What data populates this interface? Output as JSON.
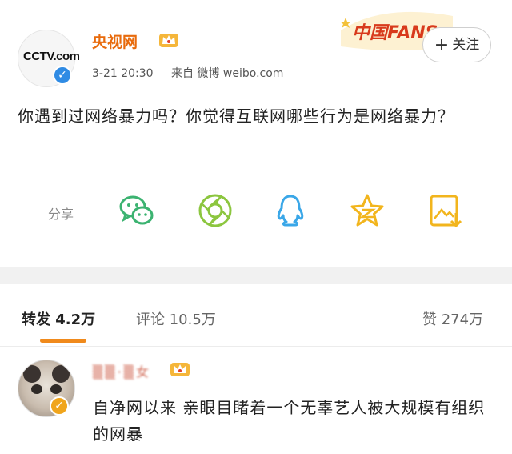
{
  "post": {
    "author": "央视网",
    "avatar_logo": "CCTV.com",
    "avatar_logo_small": "央视网",
    "time": "3-21 20:30",
    "source": "来自 微博 weibo.com",
    "follow_label": "关注",
    "text": "你遇到过网络暴力吗？你觉得互联网哪些行为是网络暴力？",
    "share_label": "分享",
    "share_icons": [
      "wechat-icon",
      "moments-icon",
      "qq-icon",
      "qzone-star-icon",
      "save-image-icon"
    ],
    "fans_badge": "中国FANS"
  },
  "stats": {
    "repost_label": "转发",
    "repost_count": "4.2万",
    "comment_label": "评论",
    "comment_count": "10.5万",
    "like_label": "赞",
    "like_count": "274万"
  },
  "comment": {
    "text": "自净网以来 亲眼目睹着一个无辜艺人被大规模有组织的网暴"
  },
  "colors": {
    "name_orange": "#e86b0d",
    "verified_blue": "#2f8be4",
    "tab_underline": "#f08a1c",
    "icon_green": "#3cb371",
    "icon_yellow": "#f2b51d"
  }
}
